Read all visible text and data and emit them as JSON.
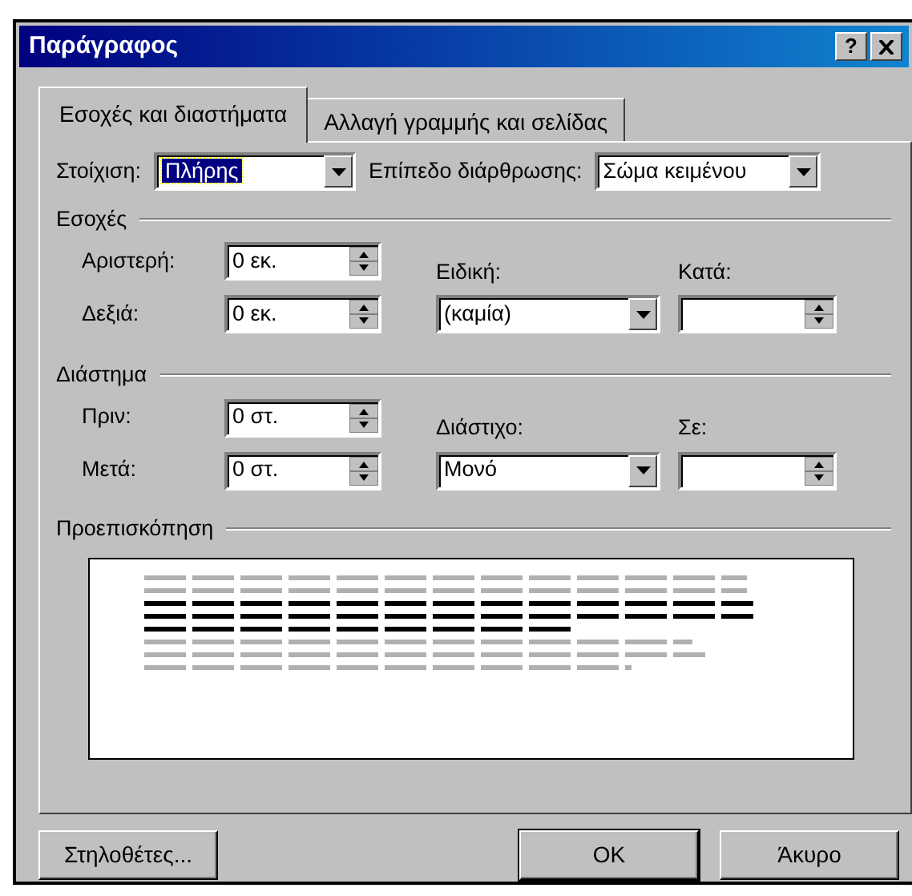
{
  "window": {
    "title": "Παράγραφος",
    "help": "?"
  },
  "tabs": [
    {
      "label": "Εσοχές και διαστήματα",
      "selected": true
    },
    {
      "label": "Αλλαγή γραμμής και σελίδας",
      "selected": false
    }
  ],
  "general": {
    "alignment": {
      "label": "Στοίχιση:",
      "value": "Πλήρης",
      "focused": true
    },
    "outline_level": {
      "label": "Επίπεδο διάρθρωσης:",
      "value": "Σώμα κειμένου"
    }
  },
  "indentation": {
    "title": "Εσοχές",
    "left": {
      "label": "Αριστερή:",
      "value": "0 εκ."
    },
    "right": {
      "label": "Δεξιά:",
      "value": "0 εκ."
    },
    "special": {
      "label": "Ειδική:",
      "value": "(καμία)"
    },
    "by": {
      "label": "Κατά:"
    }
  },
  "spacing": {
    "title": "Διάστημα",
    "before": {
      "label": "Πριν:",
      "value": "0 στ."
    },
    "after": {
      "label": "Μετά:",
      "value": "0 στ."
    },
    "line_spacing": {
      "label": "Διάστιχο:",
      "value": "Μονό"
    },
    "at": {
      "label": "Σε:"
    }
  },
  "preview": {
    "title": "Προεπισκόπηση"
  },
  "buttons": [
    {
      "label": "Στηλοθέτες...",
      "kind": "left"
    },
    {
      "label": "OK",
      "kind": "right"
    },
    {
      "label": "Άκυρο",
      "kind": "right"
    }
  ]
}
